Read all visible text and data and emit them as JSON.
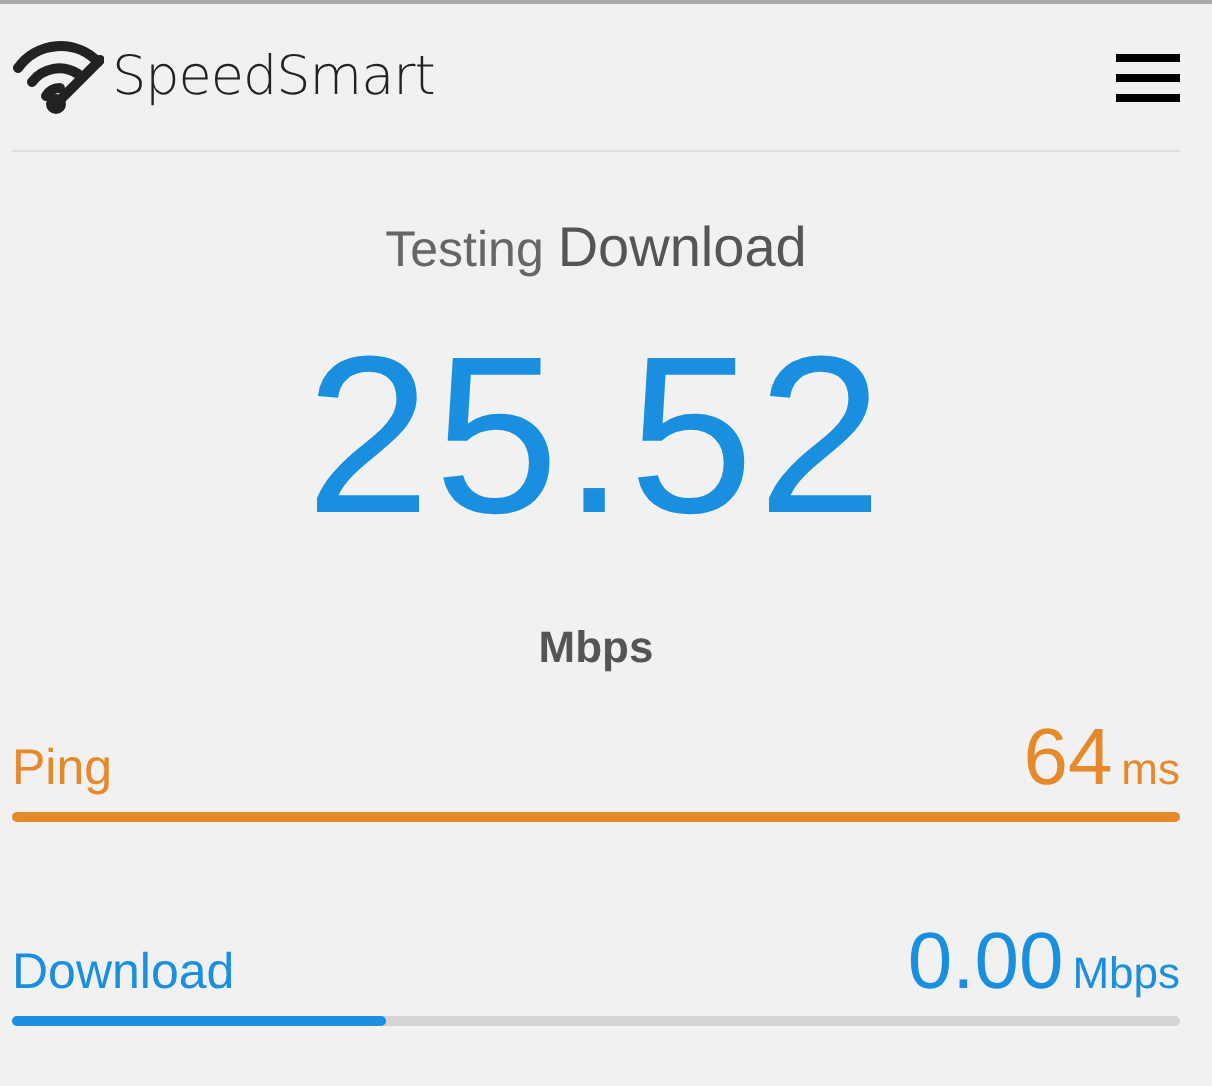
{
  "header": {
    "title": "SpeedSmart"
  },
  "test": {
    "label": "Testing",
    "phase": "Download",
    "value": "25.52",
    "unit": "Mbps"
  },
  "metrics": [
    {
      "name": "Ping",
      "value": "64",
      "unit": "ms",
      "color": "#e6892a",
      "level": 1
    },
    {
      "name": "Download",
      "value": "0.00",
      "unit": "Mbps",
      "color": "#1a8fe0",
      "level": 0.32
    }
  ]
}
